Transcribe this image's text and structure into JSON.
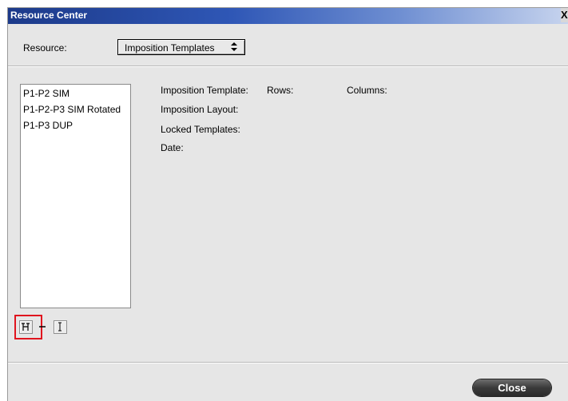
{
  "window": {
    "title": "Resource Center",
    "close_glyph": "X"
  },
  "resource": {
    "label": "Resource:",
    "selected": "Imposition Templates",
    "arrow": "↕"
  },
  "templates": [
    "P1-P2 SIM",
    "P1-P2-P3 SIM Rotated",
    "P1-P3 DUP"
  ],
  "details": {
    "imposition_template_label": "Imposition Template:",
    "rows_label": "Rows:",
    "columns_label": "Columns:",
    "imposition_layout_label": "Imposition Layout:",
    "locked_templates_label": "Locked Templates:",
    "date_label": "Date:"
  },
  "toolbar": {
    "add_icon": "add-template-icon",
    "remove_icon": "remove-template-icon",
    "rename_icon": "rename-template-icon"
  },
  "footer": {
    "close_label": "Close"
  },
  "colors": {
    "title_bar": "#1c3a8a",
    "highlight": "#e0141e",
    "close_button": "#3a3a3a"
  }
}
